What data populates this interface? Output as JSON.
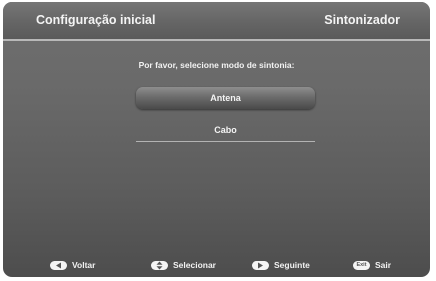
{
  "header": {
    "title": "Configuração inicial",
    "section": "Sintonizador"
  },
  "main": {
    "prompt": "Por favor, selecione modo de sintonia:",
    "options": [
      {
        "label": "Antena",
        "selected": true
      },
      {
        "label": "Cabo",
        "selected": false
      }
    ]
  },
  "footer": {
    "items": [
      {
        "icon": "left-arrow-icon",
        "label": "Voltar"
      },
      {
        "icon": "up-down-arrow-icon",
        "label": "Selecionar"
      },
      {
        "icon": "right-arrow-icon",
        "label": "Seguinte"
      },
      {
        "icon": "exit-key-icon",
        "key_text": "Exit",
        "label": "Sair"
      }
    ]
  },
  "colors": {
    "background": "#6a6a6a",
    "text": "#f4f4f4",
    "divider": "#b8b8b8"
  }
}
